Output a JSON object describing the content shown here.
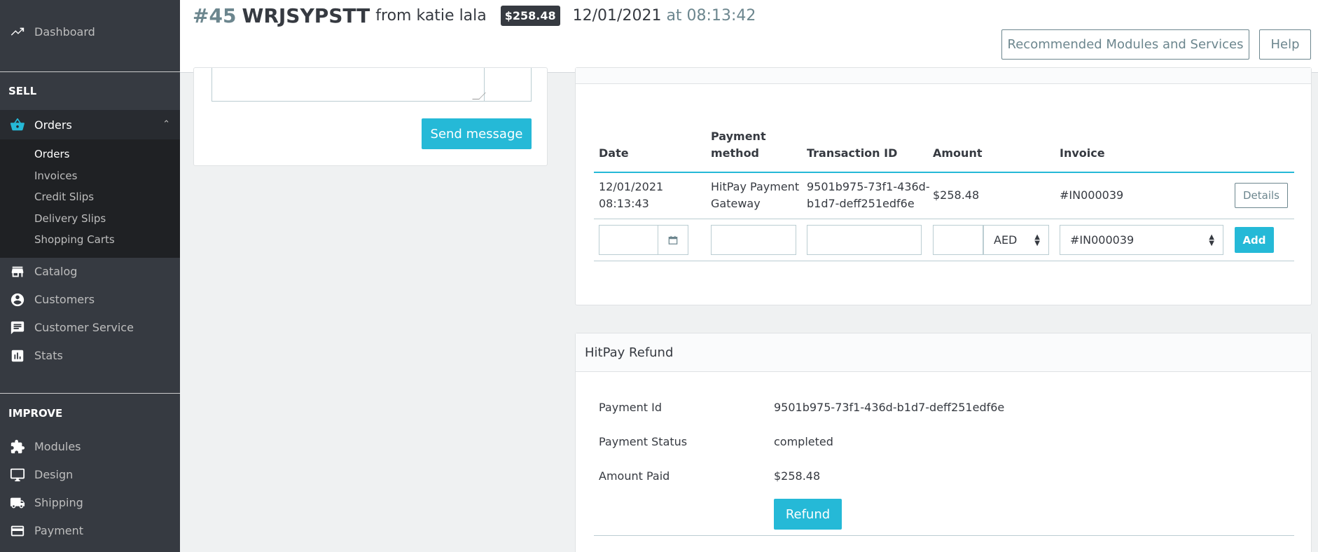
{
  "header": {
    "order_number": "#45",
    "order_reference": "WRJSYPSTT",
    "from_text": "from katie lala",
    "total_badge": "$258.48",
    "date": "12/01/2021",
    "at_text": "at 08:13:42",
    "recommended_label": "Recommended Modules and Services",
    "help_label": "Help"
  },
  "sidebar": {
    "dashboard": "Dashboard",
    "sell_section": "SELL",
    "orders": "Orders",
    "orders_sub": [
      "Orders",
      "Invoices",
      "Credit Slips",
      "Delivery Slips",
      "Shopping Carts"
    ],
    "catalog": "Catalog",
    "customers": "Customers",
    "customer_service": "Customer Service",
    "stats": "Stats",
    "improve_section": "IMPROVE",
    "modules": "Modules",
    "design": "Design",
    "shipping": "Shipping",
    "payment": "Payment"
  },
  "messages": {
    "send_label": "Send message"
  },
  "payments": {
    "columns": {
      "date": "Date",
      "method_line1": "Payment",
      "method_line2": "method",
      "transaction": "Transaction ID",
      "amount": "Amount",
      "invoice": "Invoice"
    },
    "row": {
      "date_line1": "12/01/2021",
      "date_line2": "08:13:43",
      "method_line1": "HitPay Payment",
      "method_line2": "Gateway",
      "txn_line1": "9501b975-73f1-436d-",
      "txn_line2": "b1d7-deff251edf6e",
      "amount": "$258.48",
      "invoice": "#IN000039",
      "details_label": "Details"
    },
    "form": {
      "currency": "AED",
      "invoice": "#IN000039",
      "add_label": "Add"
    }
  },
  "refund": {
    "title": "HitPay Refund",
    "payment_id_label": "Payment Id",
    "payment_id_value": "9501b975-73f1-436d-b1d7-deff251edf6e",
    "status_label": "Payment Status",
    "status_value": "completed",
    "amount_label": "Amount Paid",
    "amount_value": "$258.48",
    "refund_label": "Refund"
  },
  "colors": {
    "accent": "#25b9d7",
    "sidebar_bg": "#363a41",
    "muted": "#6c868e"
  }
}
